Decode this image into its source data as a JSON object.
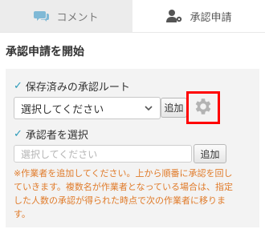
{
  "tabs": {
    "comment": {
      "label": "コメント",
      "icon": "comment-icon"
    },
    "approval": {
      "label": "承認申請",
      "icon": "user-gear-icon"
    }
  },
  "section": {
    "title": "承認申請を開始"
  },
  "saved_route": {
    "label": "保存済みの承認ルート",
    "select_value": "選択してください",
    "add_label": "追加",
    "settings_icon": "gear-icon",
    "highlight_color": "#ff0000"
  },
  "approver": {
    "label": "承認者を選択",
    "placeholder": "選択してください",
    "add_label": "追加"
  },
  "note": {
    "line1": "※作業者を追加してください。上から順番に承認を回し",
    "line2": "ていきます。複数名が作業者となっている場合は、指定",
    "line3": "した人数の承認が得られた時点で次の作業者に移りま",
    "line4": "す。"
  },
  "colors": {
    "accent_check": "#2a9ab8",
    "note_text": "#e07b2a"
  }
}
